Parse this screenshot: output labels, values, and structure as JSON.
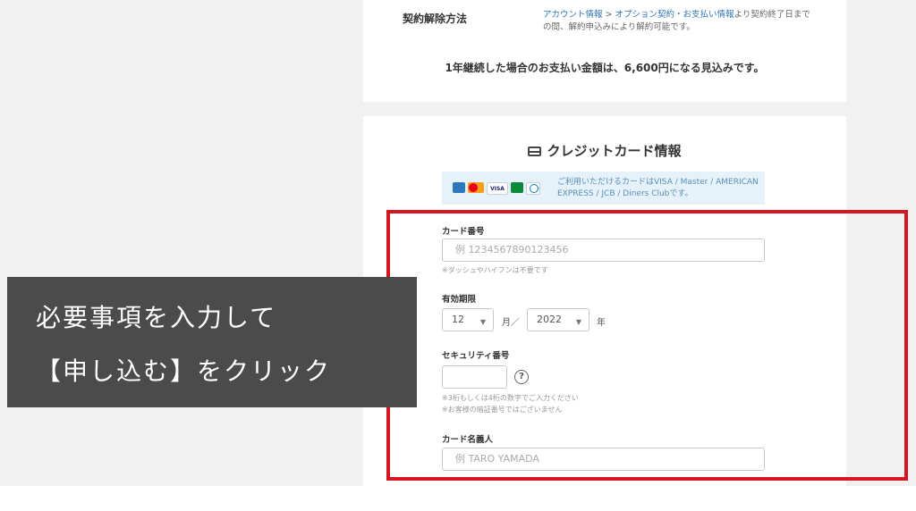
{
  "contract": {
    "cancel_label": "契約解除方法",
    "cancel_link_1": "アカウント情報",
    "cancel_sep": " > ",
    "cancel_link_2": "オプション契約・お支払い情報",
    "cancel_rest": "より契約終了日までの間、解約申込みにより解約可能です。",
    "annual_note": "1年継続した場合のお支払い金額は、6,600円になる見込みです。"
  },
  "card_section": {
    "title": "クレジットカード情報",
    "title_icon": "credit-card-icon",
    "brands": [
      "AMEX",
      "Mastercard",
      "VISA",
      "JCB",
      "Diners"
    ],
    "brands_text": "ご利用いただけるカードはVISA / Master / AMERICAN EXPRESS / JCB / Diners Clubです。"
  },
  "form": {
    "card_number_label": "カード番号",
    "card_number_placeholder": "例  1234567890123456",
    "card_number_hint": "※ダッシュやハイフンは不要です",
    "expiry_label": "有効期限",
    "expiry_month": "12",
    "expiry_month_unit": "月／",
    "expiry_year": "2022",
    "expiry_year_unit": "年",
    "security_label": "セキュリティ番号",
    "security_value": "",
    "security_hint_1": "※3桁もしくは4桁の数字でご入力ください",
    "security_hint_2": "※お客様の暗証番号ではございません",
    "holder_label": "カード名義人",
    "holder_placeholder": "例  TARO YAMADA"
  },
  "overlay": {
    "line1": "必要事項を入力して",
    "line2": "【申し込む】をクリック"
  },
  "colors": {
    "highlight": "#d4161f",
    "link": "#2d75b8",
    "overlay_bg": "#4b4b4b",
    "info_bg": "#e6f2fa"
  }
}
